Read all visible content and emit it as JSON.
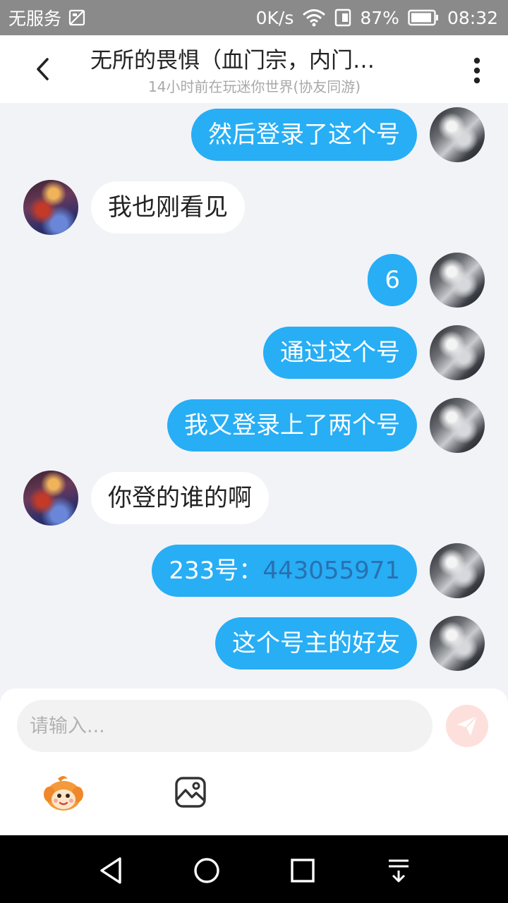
{
  "status_bar": {
    "carrier": "无服务",
    "net_speed": "0K/s",
    "battery": "87%",
    "time": "08:32"
  },
  "header": {
    "title": "无所的畏惧（血门宗，内门…",
    "subtitle": "14小时前在玩迷你世界(协友同游)"
  },
  "messages": [
    {
      "side": "mine",
      "text": "然后登录了这个号"
    },
    {
      "side": "theirs",
      "text": "我也刚看见"
    },
    {
      "side": "mine",
      "text": "6"
    },
    {
      "side": "mine",
      "text": "通过这个号"
    },
    {
      "side": "mine",
      "text": "我又登录上了两个号"
    },
    {
      "side": "theirs",
      "text": "你登的谁的啊"
    },
    {
      "side": "mine",
      "text_prefix": "233号：",
      "text_number": "443055971"
    },
    {
      "side": "mine",
      "text": "这个号主的好友"
    }
  ],
  "input": {
    "placeholder": "请输入..."
  },
  "colors": {
    "accent": "#27aef5",
    "background": "#f2f3f7",
    "send_disabled": "#fde0dc"
  },
  "icons": {
    "back": "chevron-left-icon",
    "more": "more-vertical-icon",
    "send": "paper-plane-icon",
    "emoji": "mascot-emoji-icon",
    "image": "image-icon"
  }
}
